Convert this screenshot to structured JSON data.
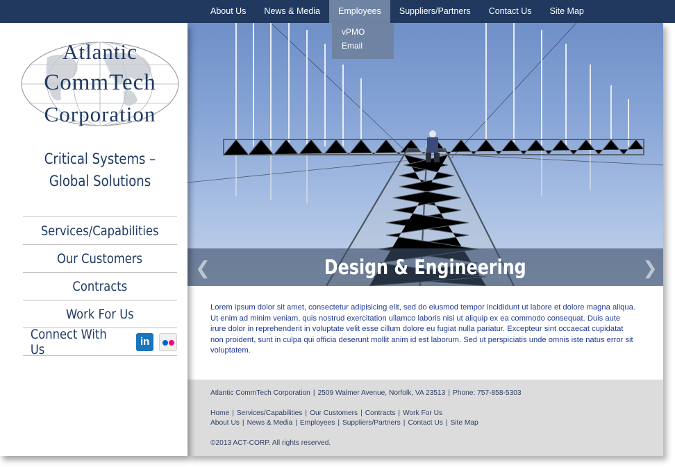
{
  "nav": {
    "items": [
      "About Us",
      "News & Media",
      "Employees",
      "Suppliers/Partners",
      "Contact Us",
      "Site Map"
    ],
    "active": "Employees",
    "dropdown": [
      "vPMO",
      "Email"
    ]
  },
  "logo": {
    "line1": "Atlantic",
    "line2": "CommTech",
    "line3": "Corporation"
  },
  "tagline": {
    "line1": "Critical Systems –",
    "line2": "Global Solutions"
  },
  "side_menu": {
    "items": [
      "Services/Capabilities",
      "Our Customers",
      "Contracts",
      "Work For Us"
    ],
    "connect": "Connect With Us",
    "linkedin_icon": "linkedin-icon",
    "flickr_icon": "flickr-icon"
  },
  "hero": {
    "caption": "Design & Engineering",
    "prev_icon": "chevron-left-icon",
    "next_icon": "chevron-right-icon"
  },
  "body_text": "Lorem ipsum dolor sit amet, consectetur adipisicing elit, sed do eiusmod tempor incididunt ut labore et dolore magna aliqua. Ut enim ad minim veniam, quis nostrud exercitation ullamco laboris nisi ut aliquip ex ea commodo consequat. Duis aute irure dolor in reprehenderit in voluptate velit esse cillum dolore eu fugiat nulla pariatur. Excepteur sint occaecat cupidatat non proident, sunt in culpa qui officia deserunt mollit anim id est laborum. Sed ut perspiciatis unde omnis iste natus error sit voluptatem.",
  "footer": {
    "company": "Atlantic CommTech Corporation",
    "address": "2509 Walmer Avenue, Norfolk, VA  23513",
    "phone": "Phone:  757-858-5303",
    "links_row1": [
      "Home",
      "Services/Capabilities",
      "Our Customers",
      "Contracts",
      "Work For Us"
    ],
    "links_row2": [
      "About Us",
      "News & Media",
      "Employees",
      "Suppliers/Partners",
      "Contact Us",
      "Site Map"
    ],
    "copyright": "©2013 ACT-CORP. All rights reserved."
  },
  "colors": {
    "nav_bg": "#21395f",
    "nav_active": "#6f83a3",
    "brand_text": "#1f3a63",
    "body_text": "#1f3a94",
    "footer_bg": "#dcdcdc"
  }
}
